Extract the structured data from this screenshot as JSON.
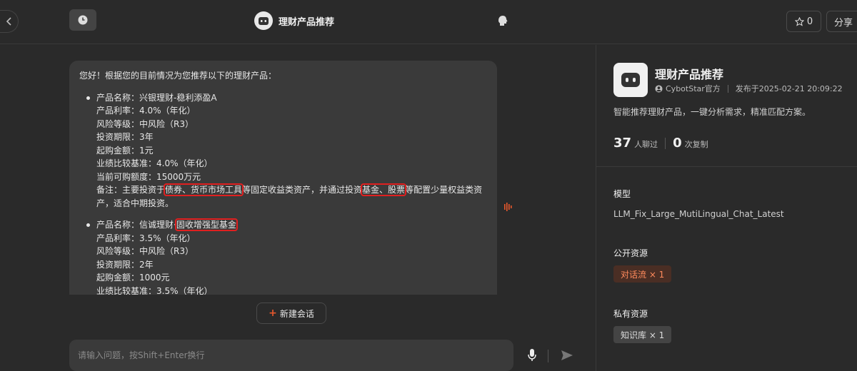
{
  "topbar": {
    "title": "理财产品推荐",
    "star_count": "0",
    "share_label": "分享"
  },
  "message": {
    "intro": "您好！根据您的目前情况为您推荐以下的理财产品：",
    "products": [
      {
        "name_label": "产品名称：",
        "name_plain": "兴银理财-稳利添盈A",
        "rate": "产品利率：4.0%（年化）",
        "risk": "风险等级：中风险（R3）",
        "period": "投资期限：3年",
        "min": "起购金额：1元",
        "benchmark": "业绩比较基准：4.0%（年化）",
        "quota": "当前可购额度：15000万元",
        "note_prefix": "备注：主要投资于",
        "note_hl1": "债券、货币市场工具",
        "note_mid": "等固定收益类资产，并通过投资",
        "note_hl2": "基金、股票",
        "note_suffix": "等配置少量权益类资产，适合中期投资。"
      },
      {
        "name_label": "产品名称：",
        "name_plain": "信诚理财·",
        "name_hl": "固收增强型基金",
        "rate": "产品利率：3.5%（年化）",
        "risk": "风险等级：中风险（R3）",
        "period": "投资期限：2年",
        "min": "起购金额：1000元",
        "benchmark": "业绩比较基准：3.5%（年化）"
      }
    ]
  },
  "new_chat_label": "新建会话",
  "input": {
    "placeholder": "请输入问题，按Shift+Enter换行"
  },
  "sidebar": {
    "title": "理财产品推荐",
    "author": "CybotStar官方",
    "published": "发布于2025-02-21 20:09:22",
    "description": "智能推荐理财产品，一键分析需求，精准匹配方案。",
    "chat_count": "37",
    "chat_label": "人聊过",
    "copy_count": "0",
    "copy_label": "次复制",
    "model_heading": "模型",
    "model_value": "LLM_Fix_Large_MutiLingual_Chat_Latest",
    "public_heading": "公开资源",
    "public_tag": "对话流 × 1",
    "private_heading": "私有资源",
    "private_tag": "知识库 × 1"
  },
  "colors": {
    "accent": "#e8582c",
    "highlight_box": "#e02020",
    "bg": "#2a2a2a",
    "bubble": "#3a3a3a"
  }
}
